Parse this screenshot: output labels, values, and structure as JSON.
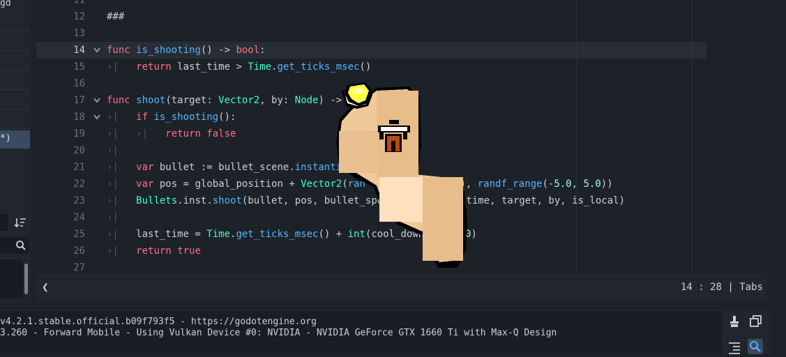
{
  "sidebar": {
    "top_text": "gd",
    "active_item": "*)"
  },
  "editor": {
    "lines": [
      {
        "num": "11",
        "code": ""
      },
      {
        "num": "12",
        "code": "###"
      },
      {
        "num": "13",
        "code": ""
      },
      {
        "num": "14",
        "code": "func is_shooting() -> bool:"
      },
      {
        "num": "15",
        "code": "return last_time > Time.get_ticks_msec()"
      },
      {
        "num": "16",
        "code": ""
      },
      {
        "num": "17",
        "code": "func shoot(target: Vector2, by: Node) ->"
      },
      {
        "num": "18",
        "code": "if is_shooting():"
      },
      {
        "num": "19",
        "code": "return false"
      },
      {
        "num": "20",
        "code": ""
      },
      {
        "num": "21",
        "code": "var bullet := bullet_scene.instantia"
      },
      {
        "num": "22",
        "code": "var pos = global_position + Vector2(ran"
      },
      {
        "num": "23",
        "code": "Bullets.inst.shoot(bullet, pos, bullet_spee"
      },
      {
        "num": "24",
        "code": ""
      },
      {
        "num": "25",
        "code": "last_time = Time.get_ticks_msec() + int(cool_down"
      },
      {
        "num": "26",
        "code": "return true"
      },
      {
        "num": "27",
        "code": ""
      }
    ],
    "line22_tail": "0), randf_range(-5.0, 5.0))",
    "line23_tail": "_time, target, by, is_local)",
    "line25_tail": "0)"
  },
  "status": {
    "collapse_icon": "chevron-left-icon",
    "position": "14 :  28 | Tabs"
  },
  "output": {
    "lines": [
      "v4.2.1.stable.official.b09f793f5 - https://godotengine.org",
      "3.260 - Forward Mobile - Using Vulkan Device #0: NVIDIA - NVIDIA GeForce GTX 1660 Ti with Max-Q Design"
    ]
  },
  "colors": {
    "keyword": "#ff7085",
    "function": "#57b3ff",
    "type": "#42ffc2",
    "number": "#a1ffe0",
    "text": "#cdcfd2"
  }
}
